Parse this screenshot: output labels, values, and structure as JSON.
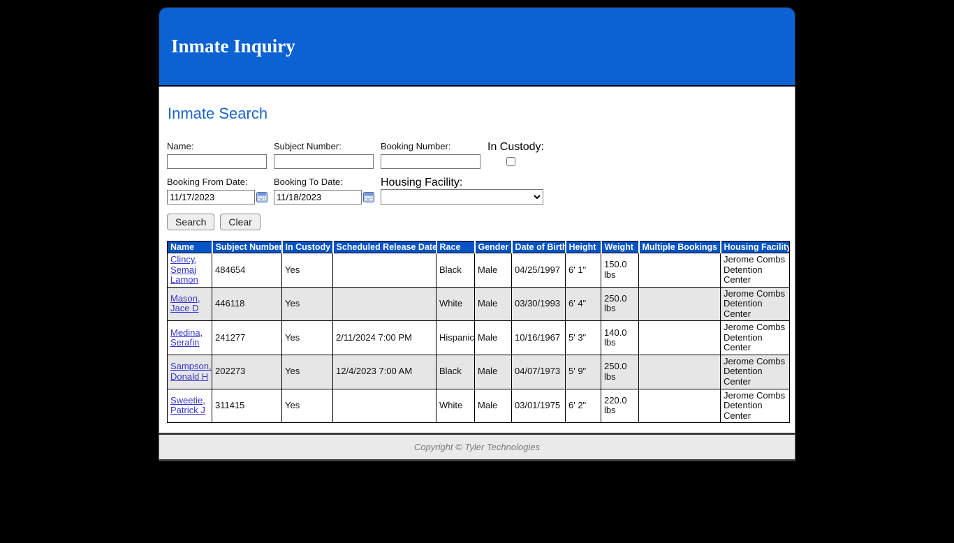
{
  "banner": {
    "title": "Inmate Inquiry"
  },
  "section": {
    "title": "Inmate Search"
  },
  "form": {
    "name_label": "Name:",
    "subject_number_label": "Subject Number:",
    "booking_number_label": "Booking Number:",
    "in_custody_label": "In Custody:",
    "booking_from_label": "Booking From Date:",
    "booking_from_value": "11/17/2023",
    "booking_to_label": "Booking To Date:",
    "booking_to_value": "11/18/2023",
    "housing_facility_label": "Housing Facility:",
    "housing_facility_value": "",
    "search_button": "Search",
    "clear_button": "Clear"
  },
  "table": {
    "columns": [
      "Name",
      "Subject Number",
      "In Custody",
      "Scheduled Release Date",
      "Race",
      "Gender",
      "Date of Birth",
      "Height",
      "Weight",
      "Multiple Bookings",
      "Housing Facility"
    ],
    "rows": [
      {
        "name": "Clincy, Semaj Lamon",
        "subject_number": "484654",
        "in_custody": "Yes",
        "scheduled_release": "",
        "race": "Black",
        "gender": "Male",
        "dob": "04/25/1997",
        "height": "6' 1\"",
        "weight": "150.0 lbs",
        "multiple_bookings": "",
        "housing_facility": "Jerome Combs Detention Center"
      },
      {
        "name": "Mason, Jace D",
        "subject_number": "446118",
        "in_custody": "Yes",
        "scheduled_release": "",
        "race": "White",
        "gender": "Male",
        "dob": "03/30/1993",
        "height": "6' 4\"",
        "weight": "250.0 lbs",
        "multiple_bookings": "",
        "housing_facility": "Jerome Combs Detention Center"
      },
      {
        "name": "Medina, Serafin",
        "subject_number": "241277",
        "in_custody": "Yes",
        "scheduled_release": "2/11/2024 7:00 PM",
        "race": "Hispanic",
        "gender": "Male",
        "dob": "10/16/1967",
        "height": "5' 3\"",
        "weight": "140.0 lbs",
        "multiple_bookings": "",
        "housing_facility": "Jerome Combs Detention Center"
      },
      {
        "name": "Sampson, Donald H",
        "subject_number": "202273",
        "in_custody": "Yes",
        "scheduled_release": "12/4/2023 7:00 AM",
        "race": "Black",
        "gender": "Male",
        "dob": "04/07/1973",
        "height": "5' 9\"",
        "weight": "250.0 lbs",
        "multiple_bookings": "",
        "housing_facility": "Jerome Combs Detention Center"
      },
      {
        "name": "Sweetie, Patrick J",
        "subject_number": "311415",
        "in_custody": "Yes",
        "scheduled_release": "",
        "race": "White",
        "gender": "Male",
        "dob": "03/01/1975",
        "height": "6' 2\"",
        "weight": "220.0 lbs",
        "multiple_bookings": "",
        "housing_facility": "Jerome Combs Detention Center"
      }
    ]
  },
  "footer": {
    "copyright": "Copyright © Tyler Technologies"
  },
  "colors": {
    "banner_blue": "#0b62d2",
    "table_header_blue": "#0553c5",
    "section_title_blue": "#1b66c9",
    "link_blue": "#3535cc",
    "row_alt_gray": "#e6e6e6",
    "footer_gray": "#eaeaea"
  }
}
